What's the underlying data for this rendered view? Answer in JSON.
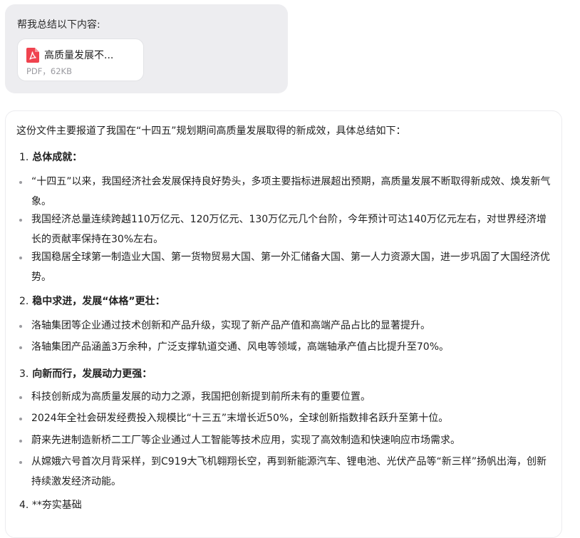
{
  "user_message": {
    "prompt": "帮我总结以下内容:",
    "file": {
      "name": "高质量发展不...",
      "meta": "PDF，62KB",
      "icon": "pdf-file-icon"
    }
  },
  "reply": {
    "intro": "这份文件主要报道了我国在“十四五”规划期间高质量发展取得的新成效，具体总结如下：",
    "sections": [
      {
        "number": "1.",
        "title": "总体成就：",
        "bullets": [
          "“十四五”以来，我国经济社会发展保持良好势头，多项主要指标进展超出预期，高质量发展不断取得新成效、焕发新气象。",
          "我国经济总量连续跨越110万亿元、120万亿元、130万亿元几个台阶，今年预计可达140万亿元左右，对世界经济增长的贡献率保持在30%左右。",
          "我国稳居全球第一制造业大国、第一货物贸易大国、第一外汇储备大国、第一人力资源大国，进一步巩固了大国经济优势。"
        ]
      },
      {
        "number": "2.",
        "title": "稳中求进，发展“体格”更壮：",
        "bullets": [
          "洛轴集团等企业通过技术创新和产品升级，实现了新产品产值和高端产品占比的显著提升。",
          "洛轴集团产品涵盖3万余种，广泛支撑轨道交通、风电等领域，高端轴承产值占比提升至70%。"
        ]
      },
      {
        "number": "3.",
        "title": "向新而行，发展动力更强：",
        "bullets": [
          "科技创新成为高质量发展的动力之源，我国把创新提到前所未有的重要位置。",
          "2024年全社会研发经费投入规模比“十三五”末增长近50%，全球创新指数排名跃升至第十位。",
          "蔚来先进制造新桥二工厂等企业通过人工智能等技术应用，实现了高效制造和快速响应市场需求。",
          "从嫦娥六号首次月背采样，到C919大飞机翱翔长空，再到新能源汽车、锂电池、光伏产品等“新三样”扬帆出海，创新持续激发经济动能。"
        ]
      },
      {
        "number": "4.",
        "title": "**夯实基础"
      }
    ]
  },
  "colors": {
    "user_bubble": "#ededf0",
    "pdf_red": "#f0434f",
    "bullet_dot": "#9b9ba0"
  }
}
